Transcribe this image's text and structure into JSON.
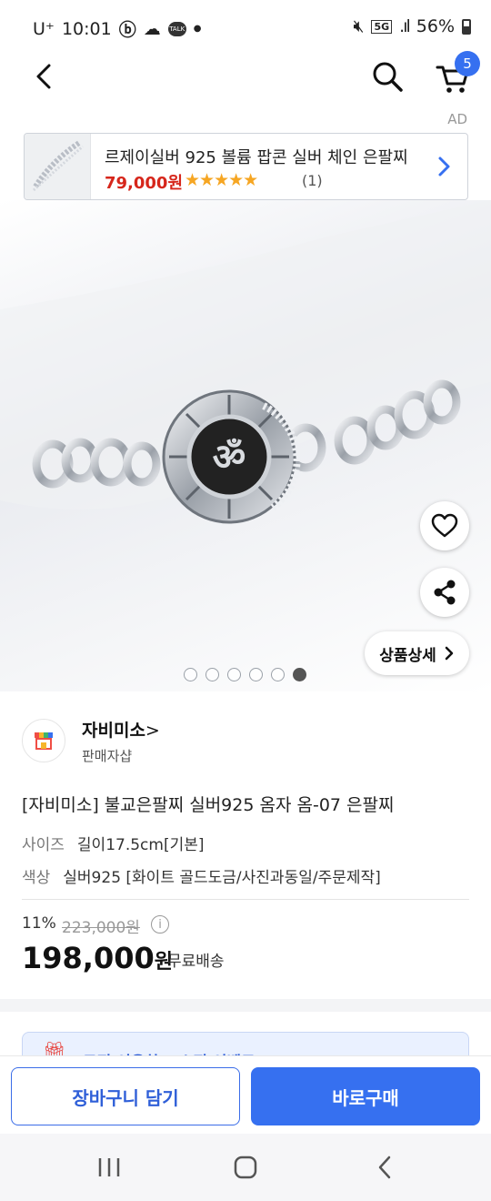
{
  "status_bar": {
    "carrier": "U⁺",
    "time": "10:01",
    "network": "5G",
    "battery": "56%"
  },
  "header": {
    "cart_count": "5"
  },
  "ad": {
    "label": "AD",
    "title": "르제이실버 925 볼륨 팝콘 실버 체인 은팔찌",
    "price": "79,000원",
    "stars": "★★★★★",
    "reviews": "(1)"
  },
  "gallery": {
    "detail_button": "상품상세",
    "image_count": 6,
    "active_index": 5
  },
  "seller": {
    "name": "자비미소",
    "chevron": ">",
    "subtitle": "판매자샵"
  },
  "product": {
    "title": "[자비미소] 불교은팔찌 실버925 옴자 옴-07 은팔찌",
    "options": [
      {
        "key": "사이즈",
        "value": "길이17.5cm[기본]"
      },
      {
        "key": "색상",
        "value": "실버925 [화이트 골드도금/사진과동일/주문제작]"
      }
    ],
    "discount": "11%",
    "original_price": "223,000원",
    "price": "198,000",
    "price_unit": "원",
    "shipping": "무료배송"
  },
  "promo": {
    "text": "토픽 이용하고 쇼핑 이벤트"
  },
  "actions": {
    "cart_label": "장바구니 담기",
    "buy_label": "바로구매"
  },
  "colors": {
    "accent": "#3670f0",
    "price_red": "#d6261b",
    "star": "#f6a623"
  }
}
